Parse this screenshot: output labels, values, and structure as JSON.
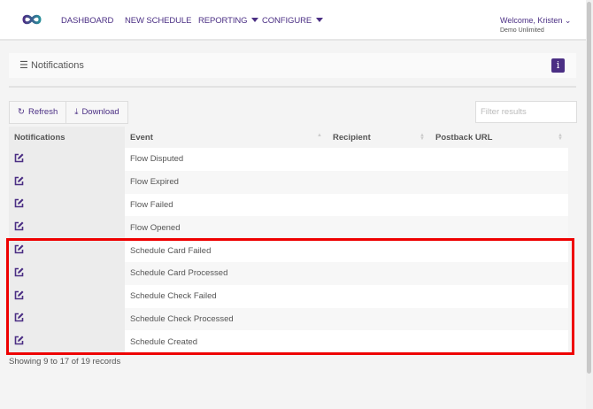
{
  "nav": {
    "items": [
      "DASHBOARD",
      "NEW SCHEDULE",
      "REPORTING",
      "CONFIGURE"
    ],
    "welcome": "Welcome, Kristen",
    "org": "Demo Unlimited"
  },
  "panel": {
    "title": "Notifications",
    "info": "i"
  },
  "toolbar": {
    "refresh": "Refresh",
    "download": "Download",
    "filter_placeholder": "Filter results"
  },
  "table": {
    "headers": [
      "Notifications",
      "Event",
      "Recipient",
      "Postback URL"
    ],
    "rows": [
      {
        "event": "Flow Disputed"
      },
      {
        "event": "Flow Expired"
      },
      {
        "event": "Flow Failed"
      },
      {
        "event": "Flow Opened"
      },
      {
        "event": "Schedule Card Failed"
      },
      {
        "event": "Schedule Card Processed"
      },
      {
        "event": "Schedule Check Failed"
      },
      {
        "event": "Schedule Check Processed"
      },
      {
        "event": "Schedule Created"
      }
    ]
  },
  "footer": "Showing 9 to 17 of 19 records",
  "colors": {
    "brand": "#4b2f84",
    "highlight": "#e00000"
  }
}
